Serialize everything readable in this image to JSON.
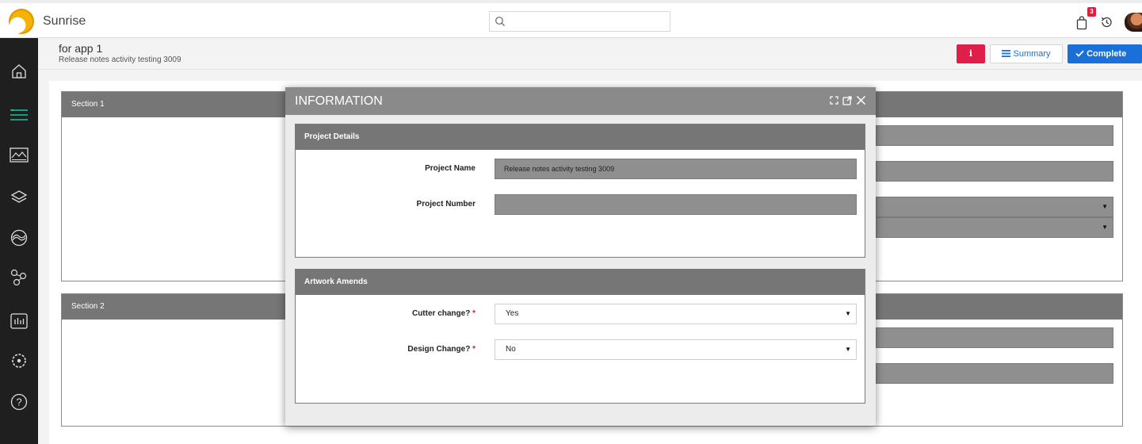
{
  "app": {
    "name": "Sunrise"
  },
  "header": {
    "search_placeholder": "",
    "notifications_count": "3"
  },
  "page": {
    "title": "for app 1",
    "subtitle": "Release notes activity testing 3009",
    "buttons": {
      "info": "i",
      "summary": "Summary",
      "complete": "Complete"
    }
  },
  "sidebar": {
    "items": [
      {
        "icon": "home-icon"
      },
      {
        "icon": "list-icon"
      },
      {
        "icon": "image-icon"
      },
      {
        "icon": "layers-icon"
      },
      {
        "icon": "circle-wave-icon"
      },
      {
        "icon": "workflow-icon"
      },
      {
        "icon": "bar-chart-icon"
      },
      {
        "icon": "settings-icon"
      },
      {
        "icon": "help-icon"
      }
    ]
  },
  "background": {
    "section1": "Section 1",
    "section2": "Section 2"
  },
  "modal": {
    "title": "INFORMATION",
    "project_details": {
      "heading": "Project Details",
      "project_name_label": "Project Name",
      "project_name_value": "Release notes activity testing 3009",
      "project_number_label": "Project Number",
      "project_number_value": ""
    },
    "artwork_amends": {
      "heading": "Artwork Amends",
      "cutter_label": "Cutter change?",
      "cutter_value": "Yes",
      "design_label": "Design Change?",
      "design_value": "No",
      "required_mark": "*"
    }
  },
  "colors": {
    "info_button": "#e01e4a",
    "complete_button": "#1a6fd8",
    "sidebar_bg": "#1f1f1f",
    "sidebar_active": "#19c6a0",
    "section_header": "#767676"
  }
}
